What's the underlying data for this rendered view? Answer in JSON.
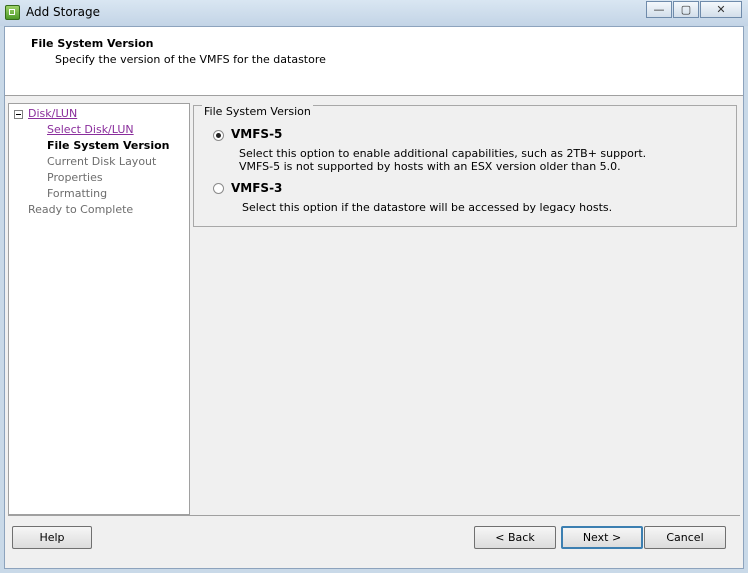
{
  "window": {
    "title": "Add Storage",
    "minimize_glyph": "—",
    "maximize_glyph": "▢",
    "close_glyph": "✕"
  },
  "header": {
    "title": "File System Version",
    "subtitle": "Specify the version of the VMFS for the datastore"
  },
  "nav": {
    "items": [
      {
        "label": "Disk/LUN",
        "state": "link"
      },
      {
        "label": "Select Disk/LUN",
        "state": "link"
      },
      {
        "label": "File System Version",
        "state": "current"
      },
      {
        "label": "Current Disk Layout",
        "state": "disabled"
      },
      {
        "label": "Properties",
        "state": "disabled"
      },
      {
        "label": "Formatting",
        "state": "disabled"
      },
      {
        "label": "Ready to Complete",
        "state": "disabled"
      }
    ]
  },
  "main": {
    "group_title": "File System Version",
    "options": [
      {
        "label": "VMFS-5",
        "selected": true,
        "desc_line1": "Select this option to enable additional capabilities, such as 2TB+ support.",
        "desc_line2": "VMFS-5 is not supported by hosts with an ESX version older than 5.0."
      },
      {
        "label": "VMFS-3",
        "selected": false,
        "desc_line1": "Select this option if the datastore will be accessed by legacy hosts."
      }
    ]
  },
  "footer": {
    "help_label": "Help",
    "back_label": "< Back",
    "next_label": "Next >",
    "cancel_label": "Cancel"
  },
  "colors": {
    "link": "#8a2d9c",
    "default_button_border": "#3c7fb1"
  }
}
